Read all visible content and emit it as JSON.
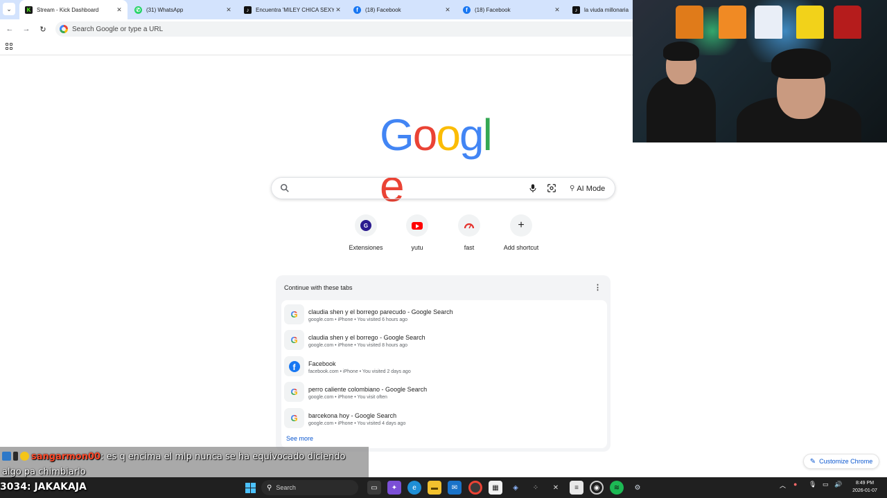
{
  "tabs": [
    {
      "title": "Stream - Kick Dashboard",
      "favicon": "kick-icon",
      "active": true
    },
    {
      "title": "(31) WhatsApp",
      "favicon": "whatsapp-icon"
    },
    {
      "title": "Encuentra 'MILEY CHICA SEXY",
      "favicon": "tiktok-icon"
    },
    {
      "title": "(18) Facebook",
      "favicon": "facebook-icon"
    },
    {
      "title": "(18) Facebook",
      "favicon": "facebook-icon"
    },
    {
      "title": "la viuda millonaria (",
      "favicon": "tiktok-icon"
    }
  ],
  "tab_close": "✕",
  "omnibox": {
    "placeholder": "Search Google or type a URL"
  },
  "logo": {
    "text": "Google"
  },
  "search": {
    "ai_mode_label": "AI Mode"
  },
  "shortcuts": [
    {
      "label": "Extensiones",
      "icon": "g-letter-icon",
      "letter": "G"
    },
    {
      "label": "yutu",
      "icon": "youtube-icon"
    },
    {
      "label": "fast",
      "icon": "speedometer-icon"
    },
    {
      "label": "Add shortcut",
      "icon": "plus-icon"
    }
  ],
  "continue_tabs": {
    "heading": "Continue with these tabs",
    "items": [
      {
        "title": "claudia shen y el borrego parecudo - Google Search",
        "subtitle": "google.com • iPhone • You visited 6 hours ago",
        "icon": "google-icon"
      },
      {
        "title": "claudia shen y el borrego - Google Search",
        "subtitle": "google.com • iPhone • You visited 8 hours ago",
        "icon": "google-icon"
      },
      {
        "title": "Facebook",
        "subtitle": "facebook.com • iPhone • You visited 2 days ago",
        "icon": "facebook-icon"
      },
      {
        "title": "perro caliente colombiano - Google Search",
        "subtitle": "google.com • iPhone • You visit often",
        "icon": "google-icon"
      },
      {
        "title": "barcekona hoy - Google Search",
        "subtitle": "google.com • iPhone • You visited 4 days ago",
        "icon": "google-icon"
      }
    ],
    "see_more": "See more"
  },
  "customize": {
    "label": "Customize Chrome"
  },
  "chat": {
    "username": "sangarmon00",
    "message": ": es q encima el mlp nunca se ha equivocado diciendo algo pa chimbiarlo"
  },
  "bottom_overlay": {
    "number": "3034",
    "text": ": JAKAKAJA"
  },
  "taskbar": {
    "search_label": "Search",
    "time": "8:49 PM",
    "date": "2026-01-07"
  },
  "colors": {
    "tabstrip": "#d3e3fd",
    "link_blue": "#0b57d0",
    "google_blue": "#4285f4",
    "google_red": "#ea4335",
    "google_yellow": "#fbbc05",
    "google_green": "#34a853",
    "chat_username": "#ff4a2b",
    "taskbar": "#202020"
  }
}
